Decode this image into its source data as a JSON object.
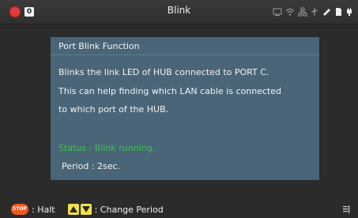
{
  "titlebar": {
    "title": "Blink",
    "badge": "0",
    "record_color": "#e23a3a",
    "tray_icons": [
      "cast-icon",
      "wifi-icon",
      "network-icon",
      "usb-icon",
      "bluetooth-icon",
      "storage-icon",
      "power-plug-icon"
    ]
  },
  "panel": {
    "title": "Port Blink Function",
    "description": [
      "Blinks the link LED of HUB connected to PORT C.",
      "This can help finding which LAN cable is connected",
      "to which port of the HUB."
    ],
    "status": "Status : Blink running.",
    "status_color": "#3cc24e",
    "period": "Period : 2sec."
  },
  "bottombar": {
    "stop_label": "STOP",
    "halt_label": ": Halt",
    "change_label": ": Change Period",
    "stop_color": "#ef5a22",
    "arrow_color": "#f2e24a"
  }
}
